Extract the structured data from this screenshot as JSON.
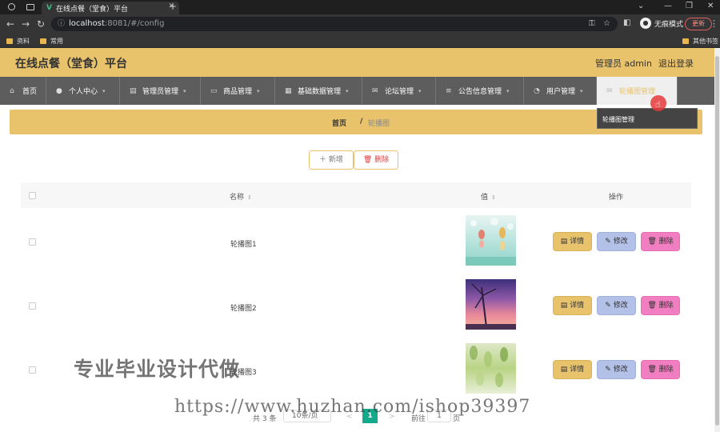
{
  "browser": {
    "tab_title": "在线点餐（堂食）平台",
    "url_host": "localhost",
    "url_rest": ":8081/#/config",
    "profile_label": "无痕模式",
    "update_label": "更新",
    "bookmarks": [
      "资料",
      "常用"
    ],
    "other_bookmarks": "其他书签"
  },
  "header": {
    "title": "在线点餐（堂食）平台",
    "admin": "管理员 admin",
    "logout": "退出登录"
  },
  "nav": {
    "items": [
      {
        "label": "首页",
        "icon": "home-icon"
      },
      {
        "label": "个人中心",
        "icon": "user-icon"
      },
      {
        "label": "管理员管理",
        "icon": "admin-icon"
      },
      {
        "label": "商品管理",
        "icon": "monitor-icon"
      },
      {
        "label": "基础数据管理",
        "icon": "list-icon"
      },
      {
        "label": "论坛管理",
        "icon": "mail-icon"
      },
      {
        "label": "公告信息管理",
        "icon": "menu-icon"
      },
      {
        "label": "用户管理",
        "icon": "users-icon"
      },
      {
        "label": "轮播图管理",
        "icon": "image-icon"
      }
    ],
    "dropdown_item": "轮播图管理"
  },
  "breadcrumb": {
    "home": "首页",
    "separator": "/",
    "current": "轮播图"
  },
  "actions": {
    "add": "＋ 新增",
    "delete": "🗑 删除"
  },
  "table": {
    "col_name": "名称",
    "col_value": "值",
    "col_ops": "操作",
    "rows": [
      {
        "name": "轮播图1"
      },
      {
        "name": "轮播图2"
      },
      {
        "name": "轮播图3"
      }
    ],
    "op_detail": "详情",
    "op_edit": "修改",
    "op_delete": "删除"
  },
  "pager": {
    "total": "共 3 条",
    "size": "10条/页",
    "prev": "<",
    "current": "1",
    "next": ">",
    "goto": "前往",
    "jump": "1",
    "page_suffix": "页"
  },
  "watermark": {
    "line1": "专业毕业设计代做",
    "line2": "https://www.huzhan.com/ishop39397"
  },
  "colors": {
    "accent": "#e8c36c",
    "nav_bg": "#5d5d5d",
    "edit": "#b3c0e8",
    "delete": "#f07ec0",
    "pager_active": "#13a98a"
  }
}
